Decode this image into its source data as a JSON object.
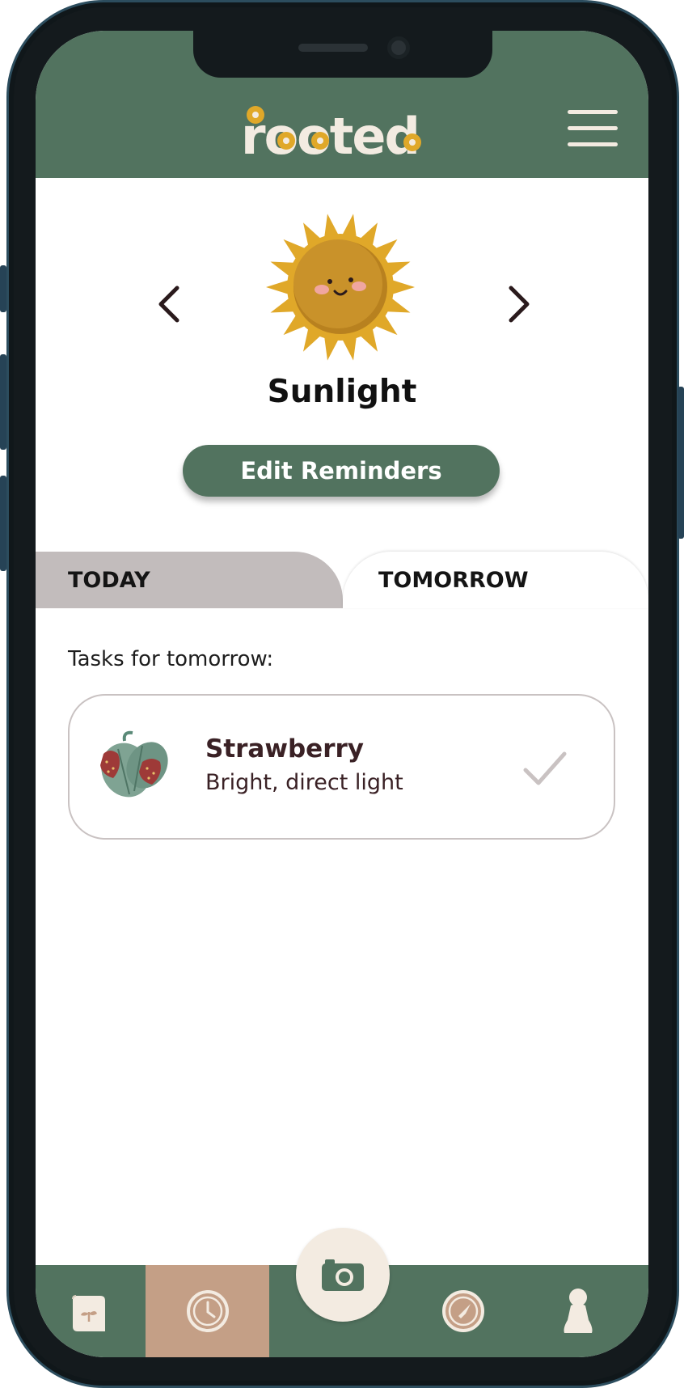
{
  "app": {
    "name": "rooted"
  },
  "colors": {
    "primary_green": "#52735f",
    "cream": "#f3ebe1",
    "sun_yellow": "#e0a829",
    "active_tab_nav": "#c49f86",
    "inactive_tab": "#c2bcbc",
    "text_dark": "#3a2125"
  },
  "header": {
    "logo_text": "rooted",
    "menu_icon": "hamburger-menu-icon"
  },
  "carousel": {
    "category_title": "Sunlight",
    "category_icon": "sun-face-icon",
    "prev_icon": "chevron-left-icon",
    "next_icon": "chevron-right-icon"
  },
  "edit_button": {
    "label": "Edit Reminders"
  },
  "tabs": [
    {
      "label": "TODAY",
      "active": false
    },
    {
      "label": "TOMORROW",
      "active": true
    }
  ],
  "tasks": {
    "heading": "Tasks for tomorrow:",
    "items": [
      {
        "name": "Strawberry",
        "detail": "Bright, direct light",
        "icon": "strawberry-plant-icon",
        "status_icon": "checkmark-icon"
      }
    ]
  },
  "bottom_nav": {
    "items": [
      {
        "name": "journal",
        "icon": "plant-journal-icon",
        "active": false
      },
      {
        "name": "reminders",
        "icon": "clock-icon",
        "active": true
      },
      {
        "name": "camera",
        "icon": "camera-icon",
        "active": false
      },
      {
        "name": "explore",
        "icon": "compass-icon",
        "active": false
      },
      {
        "name": "profile",
        "icon": "person-icon",
        "active": false
      }
    ]
  }
}
